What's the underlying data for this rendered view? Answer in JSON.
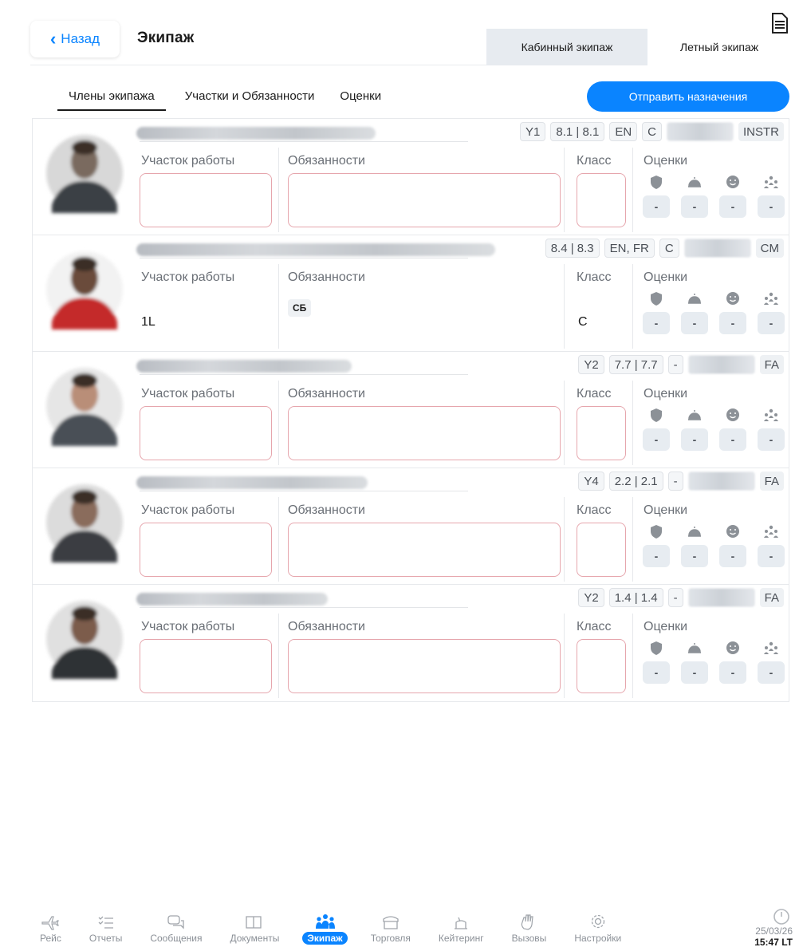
{
  "header": {
    "back_label": "Назад",
    "title": "Экипаж",
    "segments": [
      "Кабинный экипаж",
      "Летный экипаж"
    ]
  },
  "tabs": [
    "Члены экипажа",
    "Участки и Обязанности",
    "Оценки"
  ],
  "send_button": "Отправить назначения",
  "labels": {
    "work_area": "Участок работы",
    "duties": "Обязанности",
    "class": "Класс",
    "ratings": "Оценки",
    "rating_dash": "-"
  },
  "crew": [
    {
      "level": "Y1",
      "score": "8.1 | 8.1",
      "lang": "EN",
      "cls": "C",
      "position": "INSTR",
      "work_area": "",
      "duty": "",
      "class_value": ""
    },
    {
      "level": "",
      "score": "8.4 | 8.3",
      "lang": "EN, FR",
      "cls": "C",
      "position": "CM",
      "work_area": "1L",
      "duty": "СБ",
      "class_value": "C"
    },
    {
      "level": "Y2",
      "score": "7.7 | 7.7",
      "lang": "-",
      "cls": "",
      "position": "FA",
      "work_area": "",
      "duty": "",
      "class_value": ""
    },
    {
      "level": "Y4",
      "score": "2.2 | 2.1",
      "lang": "-",
      "cls": "",
      "position": "FA",
      "work_area": "",
      "duty": "",
      "class_value": ""
    },
    {
      "level": "Y2",
      "score": "1.4 | 1.4",
      "lang": "-",
      "cls": "",
      "position": "FA",
      "work_area": "",
      "duty": "",
      "class_value": ""
    }
  ],
  "nav": [
    {
      "label": "Рейс",
      "icon": "airplane-icon"
    },
    {
      "label": "Отчеты",
      "icon": "checklist-icon"
    },
    {
      "label": "Сообщения",
      "icon": "messages-icon"
    },
    {
      "label": "Документы",
      "icon": "book-icon"
    },
    {
      "label": "Экипаж",
      "icon": "crew-icon"
    },
    {
      "label": "Торговля",
      "icon": "store-icon"
    },
    {
      "label": "Кейтеринг",
      "icon": "catering-icon"
    },
    {
      "label": "Вызовы",
      "icon": "hand-icon"
    },
    {
      "label": "Настройки",
      "icon": "gear-icon"
    }
  ],
  "nav_active": "Экипаж",
  "clock": {
    "date": "25/03/26",
    "time": "15:47 LT"
  },
  "colors": {
    "accent": "#0a84ff",
    "input_border": "#e6a6ad"
  }
}
